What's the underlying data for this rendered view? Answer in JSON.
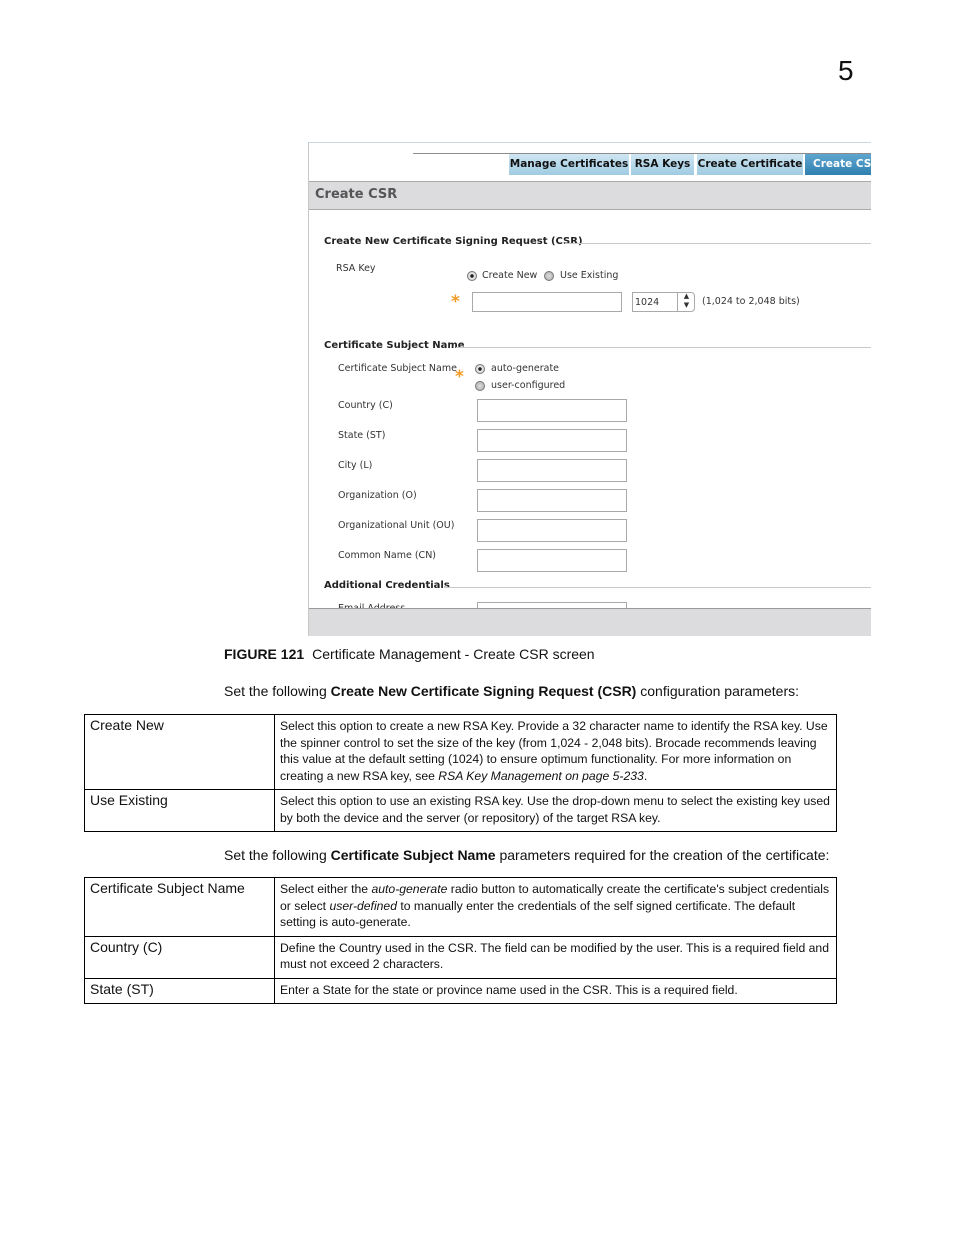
{
  "chapter_number": "5",
  "screenshot": {
    "tabs": [
      {
        "label": "Manage Certificates",
        "active": false
      },
      {
        "label": "RSA Keys",
        "active": false
      },
      {
        "label": "Create Certificate",
        "active": false
      },
      {
        "label": "Create CSR",
        "active": true
      }
    ],
    "header_title": "Create CSR",
    "section_csr": "Create New Certificate Signing Request (CSR)",
    "rsa_key_label": "RSA Key",
    "radio_create_new": "Create New",
    "radio_use_existing": "Use Existing",
    "rsa_key_selected": "Create New",
    "key_name_value": "",
    "key_size_value": "1024",
    "key_size_hint": "(1,024 to 2,048 bits)",
    "section_subject": "Certificate Subject Name",
    "subject_label": "Certificate Subject Name",
    "radio_auto": "auto-generate",
    "radio_user": "user-configured",
    "subject_selected": "auto-generate",
    "fields": [
      {
        "label": "Country (C)",
        "value": ""
      },
      {
        "label": "State (ST)",
        "value": ""
      },
      {
        "label": "City (L)",
        "value": ""
      },
      {
        "label": "Organization (O)",
        "value": ""
      },
      {
        "label": "Organizational Unit (OU)",
        "value": ""
      },
      {
        "label": "Common Name (CN)",
        "value": ""
      }
    ],
    "section_additional": "Additional Credentials",
    "email_label": "Email Address",
    "required_color": "#f39b26",
    "active_tab_color": "#2f7fb0"
  },
  "figure": {
    "number": "FIGURE 121",
    "caption": "Certificate Management - Create CSR screen"
  },
  "intro1": {
    "pre": "Set the following ",
    "bold": "Create New Certificate Signing Request (CSR)",
    "post": " configuration parameters:"
  },
  "table1": [
    {
      "term": "Create New",
      "desc": "Select this option to create a new RSA Key. Provide a 32 character name to identify the RSA key. Use the spinner control to set the size of the key (from 1,024 - 2,048 bits). Brocade recommends leaving this value at the default setting (1024) to ensure optimum functionality. For more information on creating a new RSA key, see ",
      "link": "RSA Key Management on page 5-233",
      "end": "."
    },
    {
      "term": "Use Existing",
      "desc": "Select this option to use an existing RSA key. Use the drop-down menu to select the existing key used by both the device and the server (or repository) of the target RSA key."
    }
  ],
  "intro2": {
    "pre": "Set the following ",
    "bold": "Certificate Subject Name",
    "post": " parameters required for the creation of the certificate:"
  },
  "table2": [
    {
      "term": "Certificate Subject Name",
      "d1": "Select either the ",
      "i1": "auto-generate",
      "d2": " radio button to automatically create the certificate's subject credentials or select ",
      "i2": "user-defined",
      "d3": " to manually enter the credentials of the self signed certificate. The default setting is auto-generate."
    },
    {
      "term": "Country (C)",
      "desc": "Define the Country used in the CSR. The field can be modified by the user. This is a required field and must not exceed 2 characters."
    },
    {
      "term": "State (ST)",
      "desc": "Enter a State for the state or province name used in the CSR. This is a required field."
    }
  ]
}
